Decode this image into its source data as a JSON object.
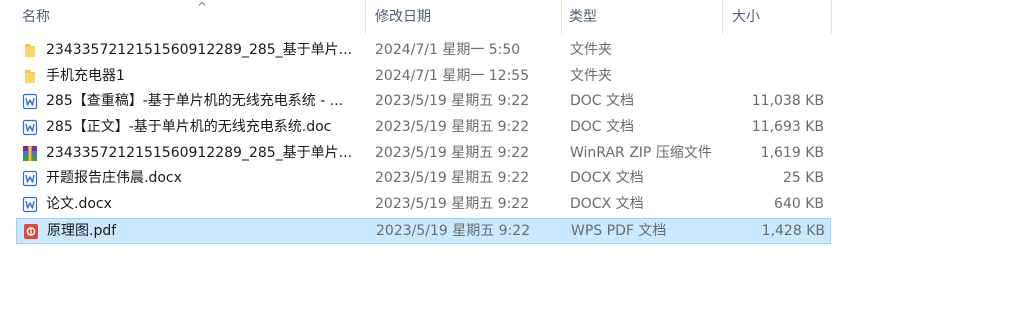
{
  "columns": {
    "name": "名称",
    "date": "修改日期",
    "type": "类型",
    "size": "大小"
  },
  "files": [
    {
      "icon": "folder-icon",
      "name": "2343357212151560912289_285_基于单片...",
      "date": "2024/7/1 星期一 5:50",
      "type": "文件夹",
      "size": ""
    },
    {
      "icon": "folder-icon",
      "name": "手机充电器1",
      "date": "2024/7/1 星期一 12:55",
      "type": "文件夹",
      "size": ""
    },
    {
      "icon": "wps-doc-icon",
      "name": "285【查重稿】-基于单片机的无线充电系统 - ...",
      "date": "2023/5/19 星期五 9:22",
      "type": "DOC 文档",
      "size": "11,038 KB"
    },
    {
      "icon": "wps-doc-icon",
      "name": "285【正文】-基于单片机的无线充电系统.doc",
      "date": "2023/5/19 星期五 9:22",
      "type": "DOC 文档",
      "size": "11,693 KB"
    },
    {
      "icon": "winrar-archive-icon",
      "name": "2343357212151560912289_285_基于单片...",
      "date": "2023/5/19 星期五 9:22",
      "type": "WinRAR ZIP 压缩文件",
      "size": "1,619 KB"
    },
    {
      "icon": "wps-doc-icon",
      "name": "开题报告庄伟晨.docx",
      "date": "2023/5/19 星期五 9:22",
      "type": "DOCX 文档",
      "size": "25 KB"
    },
    {
      "icon": "wps-doc-icon",
      "name": "论文.docx",
      "date": "2023/5/19 星期五 9:22",
      "type": "DOCX 文档",
      "size": "640 KB"
    },
    {
      "icon": "wps-pdf-icon",
      "name": "原理图.pdf",
      "date": "2023/5/19 星期五 9:22",
      "type": "WPS PDF 文档",
      "size": "1,428 KB",
      "selected": true
    }
  ],
  "colors": {
    "selection_bg": "#cce8ff",
    "selection_border": "#99d1ff",
    "header_text": "#4c607a",
    "folder": "#f8c14a",
    "wps_blue": "#2f6ce0",
    "pdf_red": "#e2473a"
  }
}
